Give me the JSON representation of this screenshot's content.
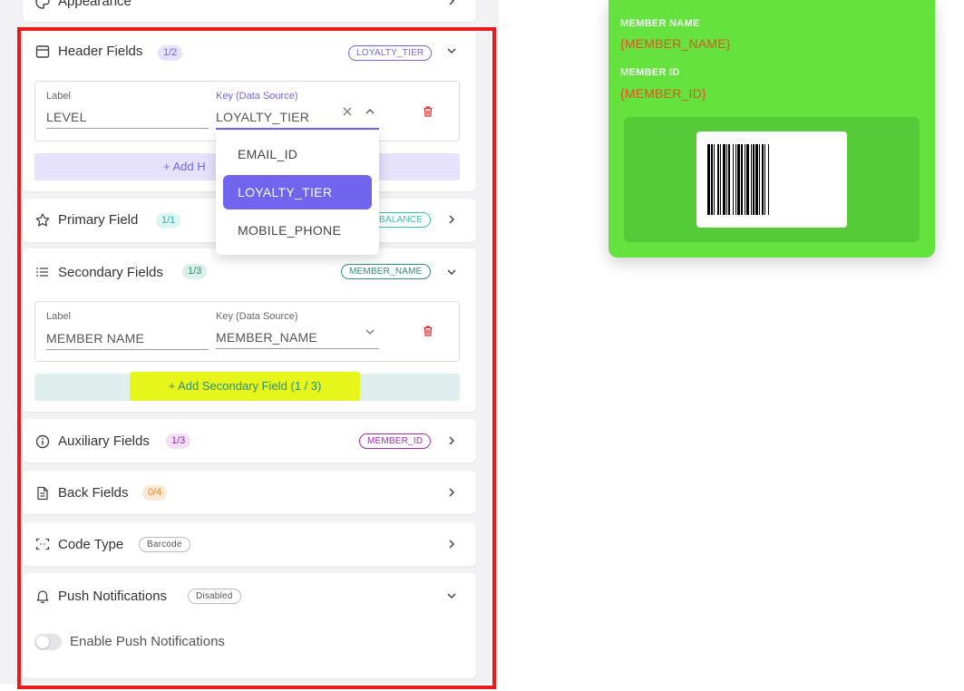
{
  "appearance": {
    "title": "Appearance"
  },
  "header_fields": {
    "title": "Header Fields",
    "count": "1/2",
    "key_pill": "LOYALTY_TIER",
    "label_caption": "Label",
    "label_value": "LEVEL",
    "key_caption": "Key (Data Source)",
    "key_value": "LOYALTY_TIER",
    "add_button": "+ Add H"
  },
  "key_dropdown": {
    "options": [
      "EMAIL_ID",
      "LOYALTY_TIER",
      "MOBILE_PHONE"
    ],
    "selected": "LOYALTY_TIER"
  },
  "primary_field": {
    "title": "Primary Field",
    "count": "1/1",
    "key_pill": "BALANCE"
  },
  "secondary_fields": {
    "title": "Secondary Fields",
    "count": "1/3",
    "key_pill": "MEMBER_NAME",
    "label_caption": "Label",
    "label_value": "MEMBER NAME",
    "key_caption": "Key (Data Source)",
    "key_value": "MEMBER_NAME",
    "add_button": "+  Add Secondary Field (1 / 3)"
  },
  "auxiliary_fields": {
    "title": "Auxiliary Fields",
    "count": "1/3",
    "key_pill": "MEMBER_ID"
  },
  "back_fields": {
    "title": "Back Fields",
    "count": "0/4"
  },
  "code_type": {
    "title": "Code Type",
    "badge": "Barcode"
  },
  "push_notifications": {
    "title": "Push Notifications",
    "badge": "Disabled",
    "toggle_label": "Enable Push Notifications",
    "enabled": false
  },
  "pass_preview": {
    "member_name_label": "MEMBER NAME",
    "member_name_value": "{MEMBER_NAME}",
    "member_id_label": "MEMBER ID",
    "member_id_value": "{MEMBER_ID}",
    "code_type": "barcode"
  },
  "colors": {
    "accent": "#7165ee",
    "pass_background": "#65e23e",
    "pass_value_text": "#e0541f",
    "highlight_box": "#e81c1c",
    "annotation_highlight": "#e6f51a"
  },
  "icons": {
    "appearance": "palette-icon",
    "header": "window-icon",
    "primary": "star-icon",
    "secondary": "list-icon",
    "auxiliary": "info-icon",
    "back": "document-icon",
    "code": "scan-icon",
    "push": "bell-icon",
    "delete": "trash-icon",
    "clear": "close-icon"
  }
}
